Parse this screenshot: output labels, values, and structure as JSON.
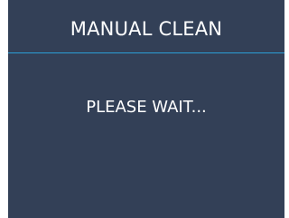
{
  "screen": {
    "title": "MANUAL CLEAN",
    "message": "PLEASE WAIT..."
  },
  "colors": {
    "background": "#334057",
    "text": "#ffffff",
    "accent_divider": "#2b9fd6"
  }
}
